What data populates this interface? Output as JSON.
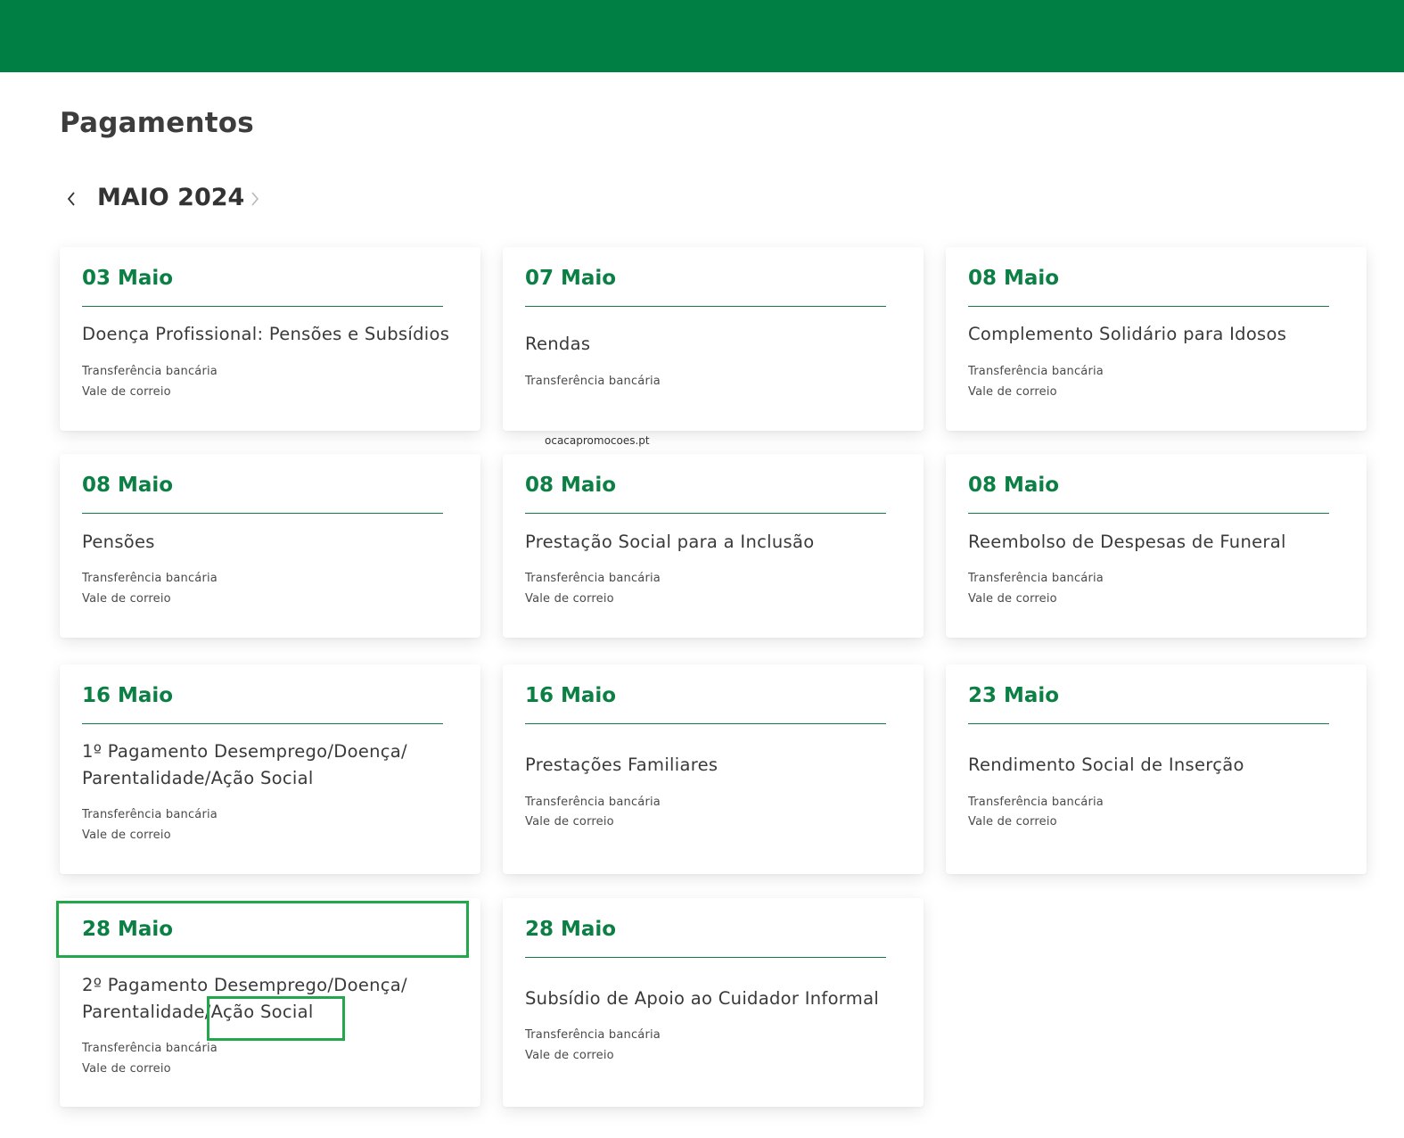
{
  "header": {
    "title": "Pagamentos"
  },
  "calendar": {
    "month_label": "MAIO 2024",
    "prev_icon": "chevron-left-icon",
    "next_icon": "chevron-right-icon"
  },
  "cards": [
    {
      "date": "03 Maio",
      "title_lines": [
        "Doença Profissional: Pensões e Subsídios"
      ],
      "methods": [
        "Transferência bancária",
        "Vale de correio"
      ]
    },
    {
      "date": "07 Maio",
      "title_lines": [
        "Rendas"
      ],
      "methods": [
        "Transferência bancária"
      ]
    },
    {
      "date": "08 Maio",
      "title_lines": [
        "Complemento Solidário para Idosos"
      ],
      "methods": [
        "Transferência bancária",
        "Vale de correio"
      ]
    },
    {
      "date": "08 Maio",
      "title_lines": [
        "Pensões"
      ],
      "methods": [
        "Transferência bancária",
        "Vale de correio"
      ]
    },
    {
      "date": "08 Maio",
      "title_lines": [
        "Prestação Social para a Inclusão"
      ],
      "methods": [
        "Transferência bancária",
        "Vale de correio"
      ]
    },
    {
      "date": "08 Maio",
      "title_lines": [
        "Reembolso de Despesas de Funeral"
      ],
      "methods": [
        "Transferência bancária",
        "Vale de correio"
      ]
    },
    {
      "date": "16 Maio",
      "title_lines": [
        "1º Pagamento Desemprego/Doença/",
        "Parentalidade/Ação Social"
      ],
      "methods": [
        "Transferência bancária",
        "Vale de correio"
      ]
    },
    {
      "date": "16 Maio",
      "title_lines": [
        "Prestações Familiares"
      ],
      "methods": [
        "Transferência bancária",
        "Vale de correio"
      ]
    },
    {
      "date": "23 Maio",
      "title_lines": [
        "Rendimento Social de Inserção"
      ],
      "methods": [
        "Transferência bancária",
        "Vale de correio"
      ]
    },
    {
      "date": "28 Maio",
      "title_lines": [
        "2º Pagamento Desemprego/Doença/",
        "Parentalidade/Ação Social"
      ],
      "methods": [
        "Transferência bancária",
        "Vale de correio"
      ]
    },
    {
      "date": "28 Maio",
      "title_lines": [
        "Subsídio de Apoio ao Cuidador Informal"
      ],
      "methods": [
        "Transferência bancária",
        "Vale de correio"
      ]
    }
  ],
  "watermark": "ocacapromocoes.pt",
  "colors": {
    "brand_green": "#007f45",
    "date_green": "#0c7f45",
    "highlight_green": "#22a84a"
  }
}
